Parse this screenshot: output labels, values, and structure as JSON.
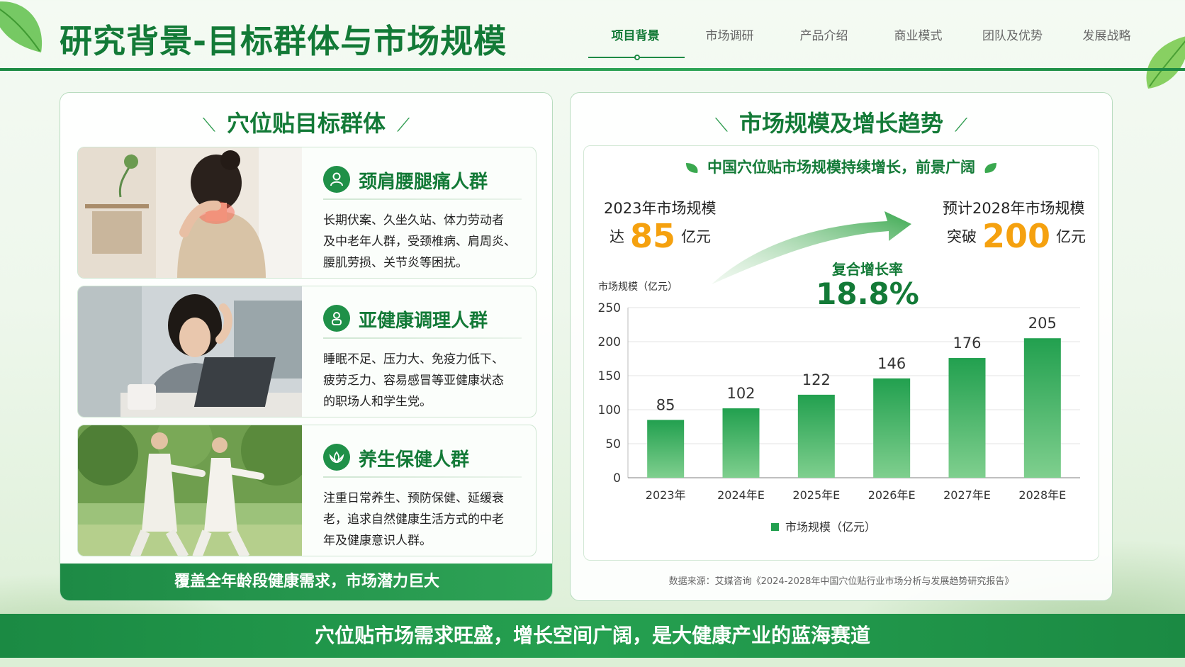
{
  "header": {
    "title": "研究背景-目标群体与市场规模",
    "tabs": [
      "项目背景",
      "市场调研",
      "产品介绍",
      "商业模式",
      "团队及优势",
      "发展战略"
    ],
    "active_tab": "项目背景"
  },
  "left_panel": {
    "title": "穴位贴目标群体",
    "groups": [
      {
        "icon": "user-icon",
        "name": "颈肩腰腿痛人群",
        "lines": [
          "长期伏案、久坐久站、体力劳动者",
          "及中老年人群，受颈椎病、肩周炎、",
          "腰肌劳损、关节炎等困扰。"
        ]
      },
      {
        "icon": "person-icon",
        "name": "亚健康调理人群",
        "lines": [
          "睡眠不足、压力大、免疫力低下、",
          "疲劳乏力、容易感冒等亚健康状态",
          "的职场人和学生党。"
        ]
      },
      {
        "icon": "lotus-icon",
        "name": "养生保健人群",
        "lines": [
          "注重日常养生、预防保健、延缓衰",
          "老，追求自然健康生活方式的中老",
          "年及健康意识人群。"
        ]
      }
    ],
    "footer": "覆盖全年龄段健康需求，市场潜力巨大"
  },
  "right_panel": {
    "title": "市场规模及增长趋势",
    "subtitle": "中国穴位贴市场规模持续增长，前景广阔",
    "stat_2023": {
      "label": "2023年市场规模",
      "prefix": "达",
      "value": "85",
      "unit": "亿元"
    },
    "stat_2028": {
      "label": "预计2028年市场规模",
      "prefix": "突破",
      "value": "200",
      "unit": "亿元"
    },
    "cagr": {
      "label": "复合增长率",
      "value": "18.8%"
    },
    "source": "数据来源：艾媒咨询《2024-2028年中国穴位贴行业市场分析与发展趋势研究报告》"
  },
  "chart_data": {
    "type": "bar",
    "categories": [
      "2023年",
      "2024年E",
      "2025年E",
      "2026年E",
      "2027年E",
      "2028年E"
    ],
    "series": [
      {
        "name": "市场规模（亿元）",
        "values": [
          85,
          102,
          122,
          146,
          176,
          205
        ]
      }
    ],
    "ylabel": "市场规模（亿元）",
    "ylim": [
      0,
      250
    ],
    "yticks": [
      0,
      50,
      100,
      150,
      200,
      250
    ],
    "grid": true,
    "legend": "bottom",
    "bar_color": "#22a04f"
  },
  "banner": "穴位贴市场需求旺盛，增长空间广阔，是大健康产业的蓝海赛道",
  "colors": {
    "primary": "#137a37",
    "accent": "#f5a10f",
    "banner": "#1f9048"
  }
}
